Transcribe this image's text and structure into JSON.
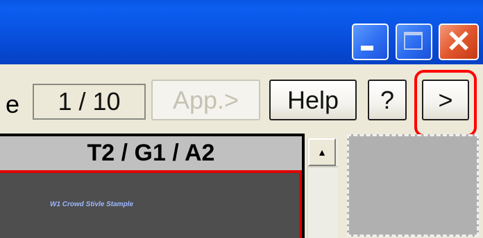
{
  "titlebar": {
    "minimize_icon": "minimize-icon",
    "maximize_icon": "maximize-icon",
    "close_icon": "close-icon",
    "close_glyph": "✕"
  },
  "toolbar": {
    "label_fragment": "e",
    "page_counter": "1 / 10",
    "app_button": "App.>",
    "help_button": "Help",
    "question_button": "?",
    "next_button": ">"
  },
  "panel": {
    "header": "T2 / G1 / A2",
    "sample_text": "W1 Crowd Stivle Stample"
  },
  "scrollbar": {
    "up_arrow": "▲"
  },
  "colors": {
    "titlebar": "#0a54e3",
    "window_bg": "#ece9d8",
    "highlight": "#ff0000",
    "panel_body": "#4e4e4e",
    "panel_border": "#e00000"
  }
}
